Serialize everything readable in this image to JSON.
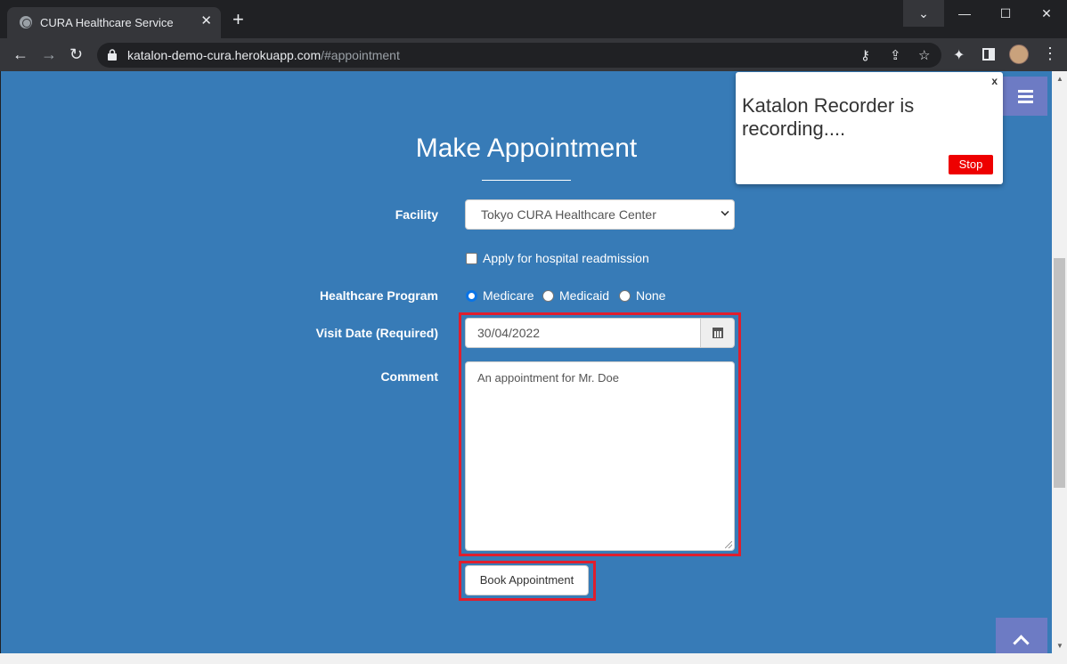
{
  "browser": {
    "tab_title": "CURA Healthcare Service",
    "tab_close": "✕",
    "new_tab": "+",
    "url_host": "katalon-demo-cura.herokuapp.com",
    "url_path": "/#appointment",
    "window_controls": {
      "chevron": "⌄",
      "minimize": "—",
      "maximize": "☐",
      "close": "✕"
    },
    "nav": {
      "back": "←",
      "forward": "→",
      "reload": "↻"
    },
    "omnibox_icons": {
      "key": "⚷",
      "share": "⇪",
      "star": "☆"
    },
    "extensions_icon": "✦",
    "menu_icon": "⋮"
  },
  "page": {
    "heading": "Make Appointment",
    "facility": {
      "label": "Facility",
      "selected": "Tokyo CURA Healthcare Center"
    },
    "readmission": {
      "label": "Apply for hospital readmission",
      "checked": false
    },
    "program": {
      "label": "Healthcare Program",
      "options": [
        "Medicare",
        "Medicaid",
        "None"
      ],
      "selected": "Medicare"
    },
    "visit_date": {
      "label": "Visit Date (Required)",
      "value": "30/04/2022"
    },
    "comment": {
      "label": "Comment",
      "value": "An appointment for Mr. Doe"
    },
    "book_button": "Book Appointment"
  },
  "katalon_popup": {
    "close": "x",
    "message": "Katalon Recorder is recording....",
    "stop": "Stop"
  },
  "colors": {
    "page_bg": "#377bb7",
    "accent": "#6d7bc4",
    "highlight": "#e01e2d",
    "stop": "#ee0000"
  }
}
